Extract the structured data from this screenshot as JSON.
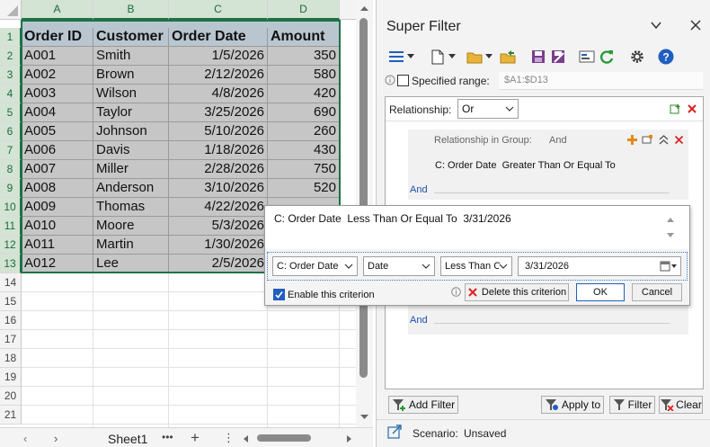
{
  "sheet": {
    "columns": [
      "A",
      "B",
      "C",
      "D"
    ],
    "rows": [
      "1",
      "2",
      "3",
      "4",
      "5",
      "6",
      "7",
      "8",
      "9",
      "10",
      "11",
      "12",
      "13",
      "14",
      "15",
      "16",
      "17",
      "18",
      "19",
      "20",
      "21"
    ],
    "headers": [
      "Order ID",
      "Customer",
      "Order Date",
      "Amount"
    ],
    "data": [
      [
        "A001",
        "Smith",
        "1/5/2026",
        "350"
      ],
      [
        "A002",
        "Brown",
        "2/12/2026",
        "580"
      ],
      [
        "A003",
        "Wilson",
        "4/8/2026",
        "420"
      ],
      [
        "A004",
        "Taylor",
        "3/25/2026",
        "690"
      ],
      [
        "A005",
        "Johnson",
        "5/10/2026",
        "260"
      ],
      [
        "A006",
        "Davis",
        "1/18/2026",
        "430"
      ],
      [
        "A007",
        "Miller",
        "2/28/2026",
        "750"
      ],
      [
        "A008",
        "Anderson",
        "3/10/2026",
        "520"
      ],
      [
        "A009",
        "Thomas",
        "4/22/2026",
        ""
      ],
      [
        "A010",
        "Moore",
        "5/3/2026",
        ""
      ],
      [
        "A011",
        "Martin",
        "1/30/2026",
        ""
      ],
      [
        "A012",
        "Lee",
        "2/5/2026",
        ""
      ]
    ],
    "tab_name": "Sheet1",
    "more": "•••",
    "add": "+",
    "kebab": "⋮"
  },
  "panel": {
    "title": "Super Filter",
    "specified_range_label": "Specified range:",
    "range_value": "$A1:$D13",
    "relationship_label": "Relationship:",
    "relationship_value": "Or",
    "group_relationship_label": "Relationship in Group:",
    "group_relationship_value": "And",
    "criterion_1": "C: Order Date  Greater Than Or Equal To",
    "and_1": "And",
    "and_2": "And",
    "add_filter": "Add Filter",
    "apply_to": "Apply to",
    "filter": "Filter",
    "clear": "Clear",
    "scenario_label": "Scenario:",
    "scenario_value": "Unsaved"
  },
  "editor": {
    "summary": "C: Order Date  Less Than Or Equal To  3/31/2026",
    "field": "C: Order Date",
    "type": "Date",
    "operator": "Less Than C",
    "value": "3/31/2026",
    "enable_label": "Enable this criterion",
    "delete_label": "Delete this criterion",
    "ok": "OK",
    "cancel": "Cancel"
  },
  "colors": {
    "header_fill": "#b9c6d0",
    "data_fill": "#c6c6c6",
    "selection_green": "#1e7145",
    "and_blue": "#1f4ea8",
    "help_blue": "#1f5fbf"
  }
}
